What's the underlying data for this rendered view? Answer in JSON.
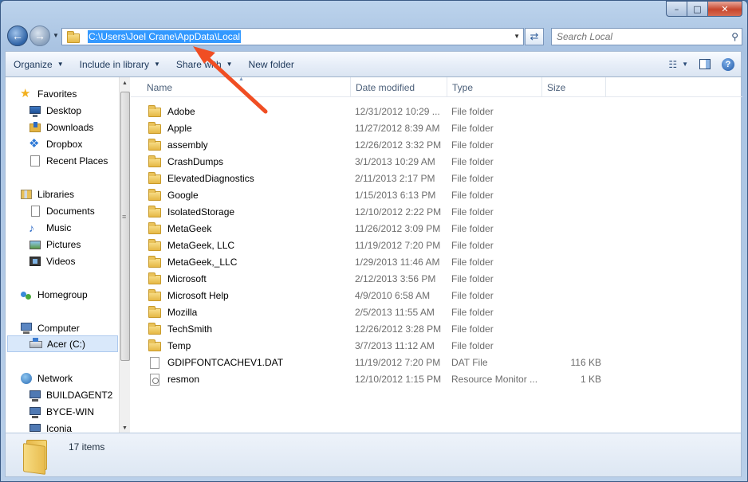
{
  "window": {
    "caption_buttons": {
      "minimize": "–",
      "maximize": "□",
      "close": "✕"
    }
  },
  "address": {
    "path": "C:\\Users\\Joel Crane\\AppData\\Local",
    "search_placeholder": "Search Local"
  },
  "toolbar": {
    "organize": "Organize",
    "include_in_library": "Include in library",
    "share_with": "Share with",
    "new_folder": "New folder"
  },
  "nav": {
    "favorites": "Favorites",
    "desktop": "Desktop",
    "downloads": "Downloads",
    "dropbox": "Dropbox",
    "recent_places": "Recent Places",
    "libraries": "Libraries",
    "documents": "Documents",
    "music": "Music",
    "pictures": "Pictures",
    "videos": "Videos",
    "homegroup": "Homegroup",
    "computer": "Computer",
    "acer": "Acer (C:)",
    "network": "Network",
    "buildagent2": "BUILDAGENT2",
    "byce_win": "BYCE-WIN",
    "iconia": "Iconia"
  },
  "columns": {
    "name": "Name",
    "date_modified": "Date modified",
    "type": "Type",
    "size": "Size"
  },
  "files": [
    {
      "name": "Adobe",
      "date": "12/31/2012 10:29 ...",
      "type": "File folder",
      "size": "",
      "kind": "folder"
    },
    {
      "name": "Apple",
      "date": "11/27/2012 8:39 AM",
      "type": "File folder",
      "size": "",
      "kind": "folder"
    },
    {
      "name": "assembly",
      "date": "12/26/2012 3:32 PM",
      "type": "File folder",
      "size": "",
      "kind": "folder"
    },
    {
      "name": "CrashDumps",
      "date": "3/1/2013 10:29 AM",
      "type": "File folder",
      "size": "",
      "kind": "folder"
    },
    {
      "name": "ElevatedDiagnostics",
      "date": "2/11/2013 2:17 PM",
      "type": "File folder",
      "size": "",
      "kind": "folder"
    },
    {
      "name": "Google",
      "date": "1/15/2013 6:13 PM",
      "type": "File folder",
      "size": "",
      "kind": "folder"
    },
    {
      "name": "IsolatedStorage",
      "date": "12/10/2012 2:22 PM",
      "type": "File folder",
      "size": "",
      "kind": "folder"
    },
    {
      "name": "MetaGeek",
      "date": "11/26/2012 3:09 PM",
      "type": "File folder",
      "size": "",
      "kind": "folder"
    },
    {
      "name": "MetaGeek, LLC",
      "date": "11/19/2012 7:20 PM",
      "type": "File folder",
      "size": "",
      "kind": "folder"
    },
    {
      "name": "MetaGeek,_LLC",
      "date": "1/29/2013 11:46 AM",
      "type": "File folder",
      "size": "",
      "kind": "folder"
    },
    {
      "name": "Microsoft",
      "date": "2/12/2013 3:56 PM",
      "type": "File folder",
      "size": "",
      "kind": "folder"
    },
    {
      "name": "Microsoft Help",
      "date": "4/9/2010 6:58 AM",
      "type": "File folder",
      "size": "",
      "kind": "folder"
    },
    {
      "name": "Mozilla",
      "date": "2/5/2013 11:55 AM",
      "type": "File folder",
      "size": "",
      "kind": "folder"
    },
    {
      "name": "TechSmith",
      "date": "12/26/2012 3:28 PM",
      "type": "File folder",
      "size": "",
      "kind": "folder"
    },
    {
      "name": "Temp",
      "date": "3/7/2013 11:12 AM",
      "type": "File folder",
      "size": "",
      "kind": "folder"
    },
    {
      "name": "GDIPFONTCACHEV1.DAT",
      "date": "11/19/2012 7:20 PM",
      "type": "DAT File",
      "size": "116 KB",
      "kind": "file"
    },
    {
      "name": "resmon",
      "date": "12/10/2012 1:15 PM",
      "type": "Resource Monitor ...",
      "size": "1 KB",
      "kind": "shortcut"
    }
  ],
  "status": {
    "item_count": "17 items"
  },
  "colors": {
    "accent": "#3399ff",
    "annotation_arrow": "#f04e23"
  }
}
